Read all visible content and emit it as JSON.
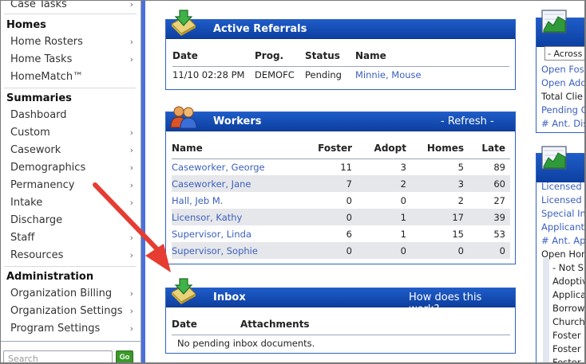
{
  "sidebar": {
    "top_item": {
      "label": "Case Tasks"
    },
    "sections": {
      "homes": "Homes",
      "summaries": "Summaries",
      "administration": "Administration"
    },
    "homes_items": [
      {
        "label": "Home Rosters"
      },
      {
        "label": "Home Tasks"
      },
      {
        "label": "HomeMatch™"
      }
    ],
    "summaries_items": [
      {
        "label": "Dashboard"
      },
      {
        "label": "Custom"
      },
      {
        "label": "Casework"
      },
      {
        "label": "Demographics"
      },
      {
        "label": "Permanency"
      },
      {
        "label": "Intake"
      },
      {
        "label": "Discharge"
      },
      {
        "label": "Staff"
      },
      {
        "label": "Resources"
      }
    ],
    "administration_items": [
      {
        "label": "Organization Billing"
      },
      {
        "label": "Organization Settings"
      },
      {
        "label": "Program Settings"
      }
    ],
    "arrow_glyph": "›",
    "search_placeholder": "Search",
    "go_label": "Go"
  },
  "active_referrals": {
    "title": "Active Referrals",
    "columns": [
      "Date",
      "Prog.",
      "Status",
      "Name"
    ],
    "rows": [
      {
        "date": "11/10 02:28 PM",
        "prog": "DEMOFC",
        "status": "Pending",
        "name": "Minnie, Mouse"
      }
    ]
  },
  "workers": {
    "title": "Workers",
    "refresh_label": "- Refresh -",
    "columns": [
      "Name",
      "Foster",
      "Adopt",
      "Homes",
      "Late"
    ],
    "rows": [
      {
        "name": "Caseworker, George",
        "foster": "11",
        "adopt": "3",
        "homes": "5",
        "late": "89"
      },
      {
        "name": "Caseworker, Jane",
        "foster": "7",
        "adopt": "2",
        "homes": "3",
        "late": "60"
      },
      {
        "name": "Hall, Jeb M.",
        "foster": "0",
        "adopt": "0",
        "homes": "2",
        "late": "27"
      },
      {
        "name": "Licensor, Kathy",
        "foster": "0",
        "adopt": "1",
        "homes": "17",
        "late": "39"
      },
      {
        "name": "Supervisor, Linda",
        "foster": "6",
        "adopt": "1",
        "homes": "15",
        "late": "53"
      },
      {
        "name": "Supervisor, Sophie",
        "foster": "0",
        "adopt": "0",
        "homes": "0",
        "late": "0"
      }
    ]
  },
  "inbox": {
    "title": "Inbox",
    "help_link": "How does this work?",
    "columns": [
      "Date",
      "Attachments"
    ],
    "empty_message": "No pending inbox documents."
  },
  "right_panel_top": {
    "select_value": "- Across",
    "lines": [
      {
        "text": "Open Fos",
        "link": true
      },
      {
        "text": "Open Ado",
        "link": true
      },
      {
        "text": "Total Clie",
        "link": false
      },
      {
        "text": "Pending C",
        "link": true
      },
      {
        "text": "# Ant. Dis",
        "link": true
      }
    ]
  },
  "right_panel_bottom": {
    "lines": [
      {
        "text": "Licensed",
        "link": true
      },
      {
        "text": "Licensed",
        "link": true
      },
      {
        "text": "Special In",
        "link": true
      },
      {
        "text": "Applicant",
        "link": true
      },
      {
        "text": "# Ant. Ap",
        "link": true
      },
      {
        "text": "Open Hom",
        "link": false
      }
    ],
    "sub_lines": [
      {
        "text": "- Not S"
      },
      {
        "text": "Adoptiv"
      },
      {
        "text": "Applica"
      },
      {
        "text": "Borrow"
      },
      {
        "text": "Church"
      },
      {
        "text": "Foster"
      },
      {
        "text": "Foster"
      },
      {
        "text": "Foster"
      }
    ]
  },
  "colors": {
    "header_blue": "#1e5cc8",
    "link_blue": "#3b5fc0",
    "annotation_arrow": "#e63c32",
    "sidebar_stripe": "#4b70d9"
  },
  "icons": [
    "tray-download-icon",
    "workers-people-icon",
    "chart-icon",
    "chevron-right-icon"
  ]
}
